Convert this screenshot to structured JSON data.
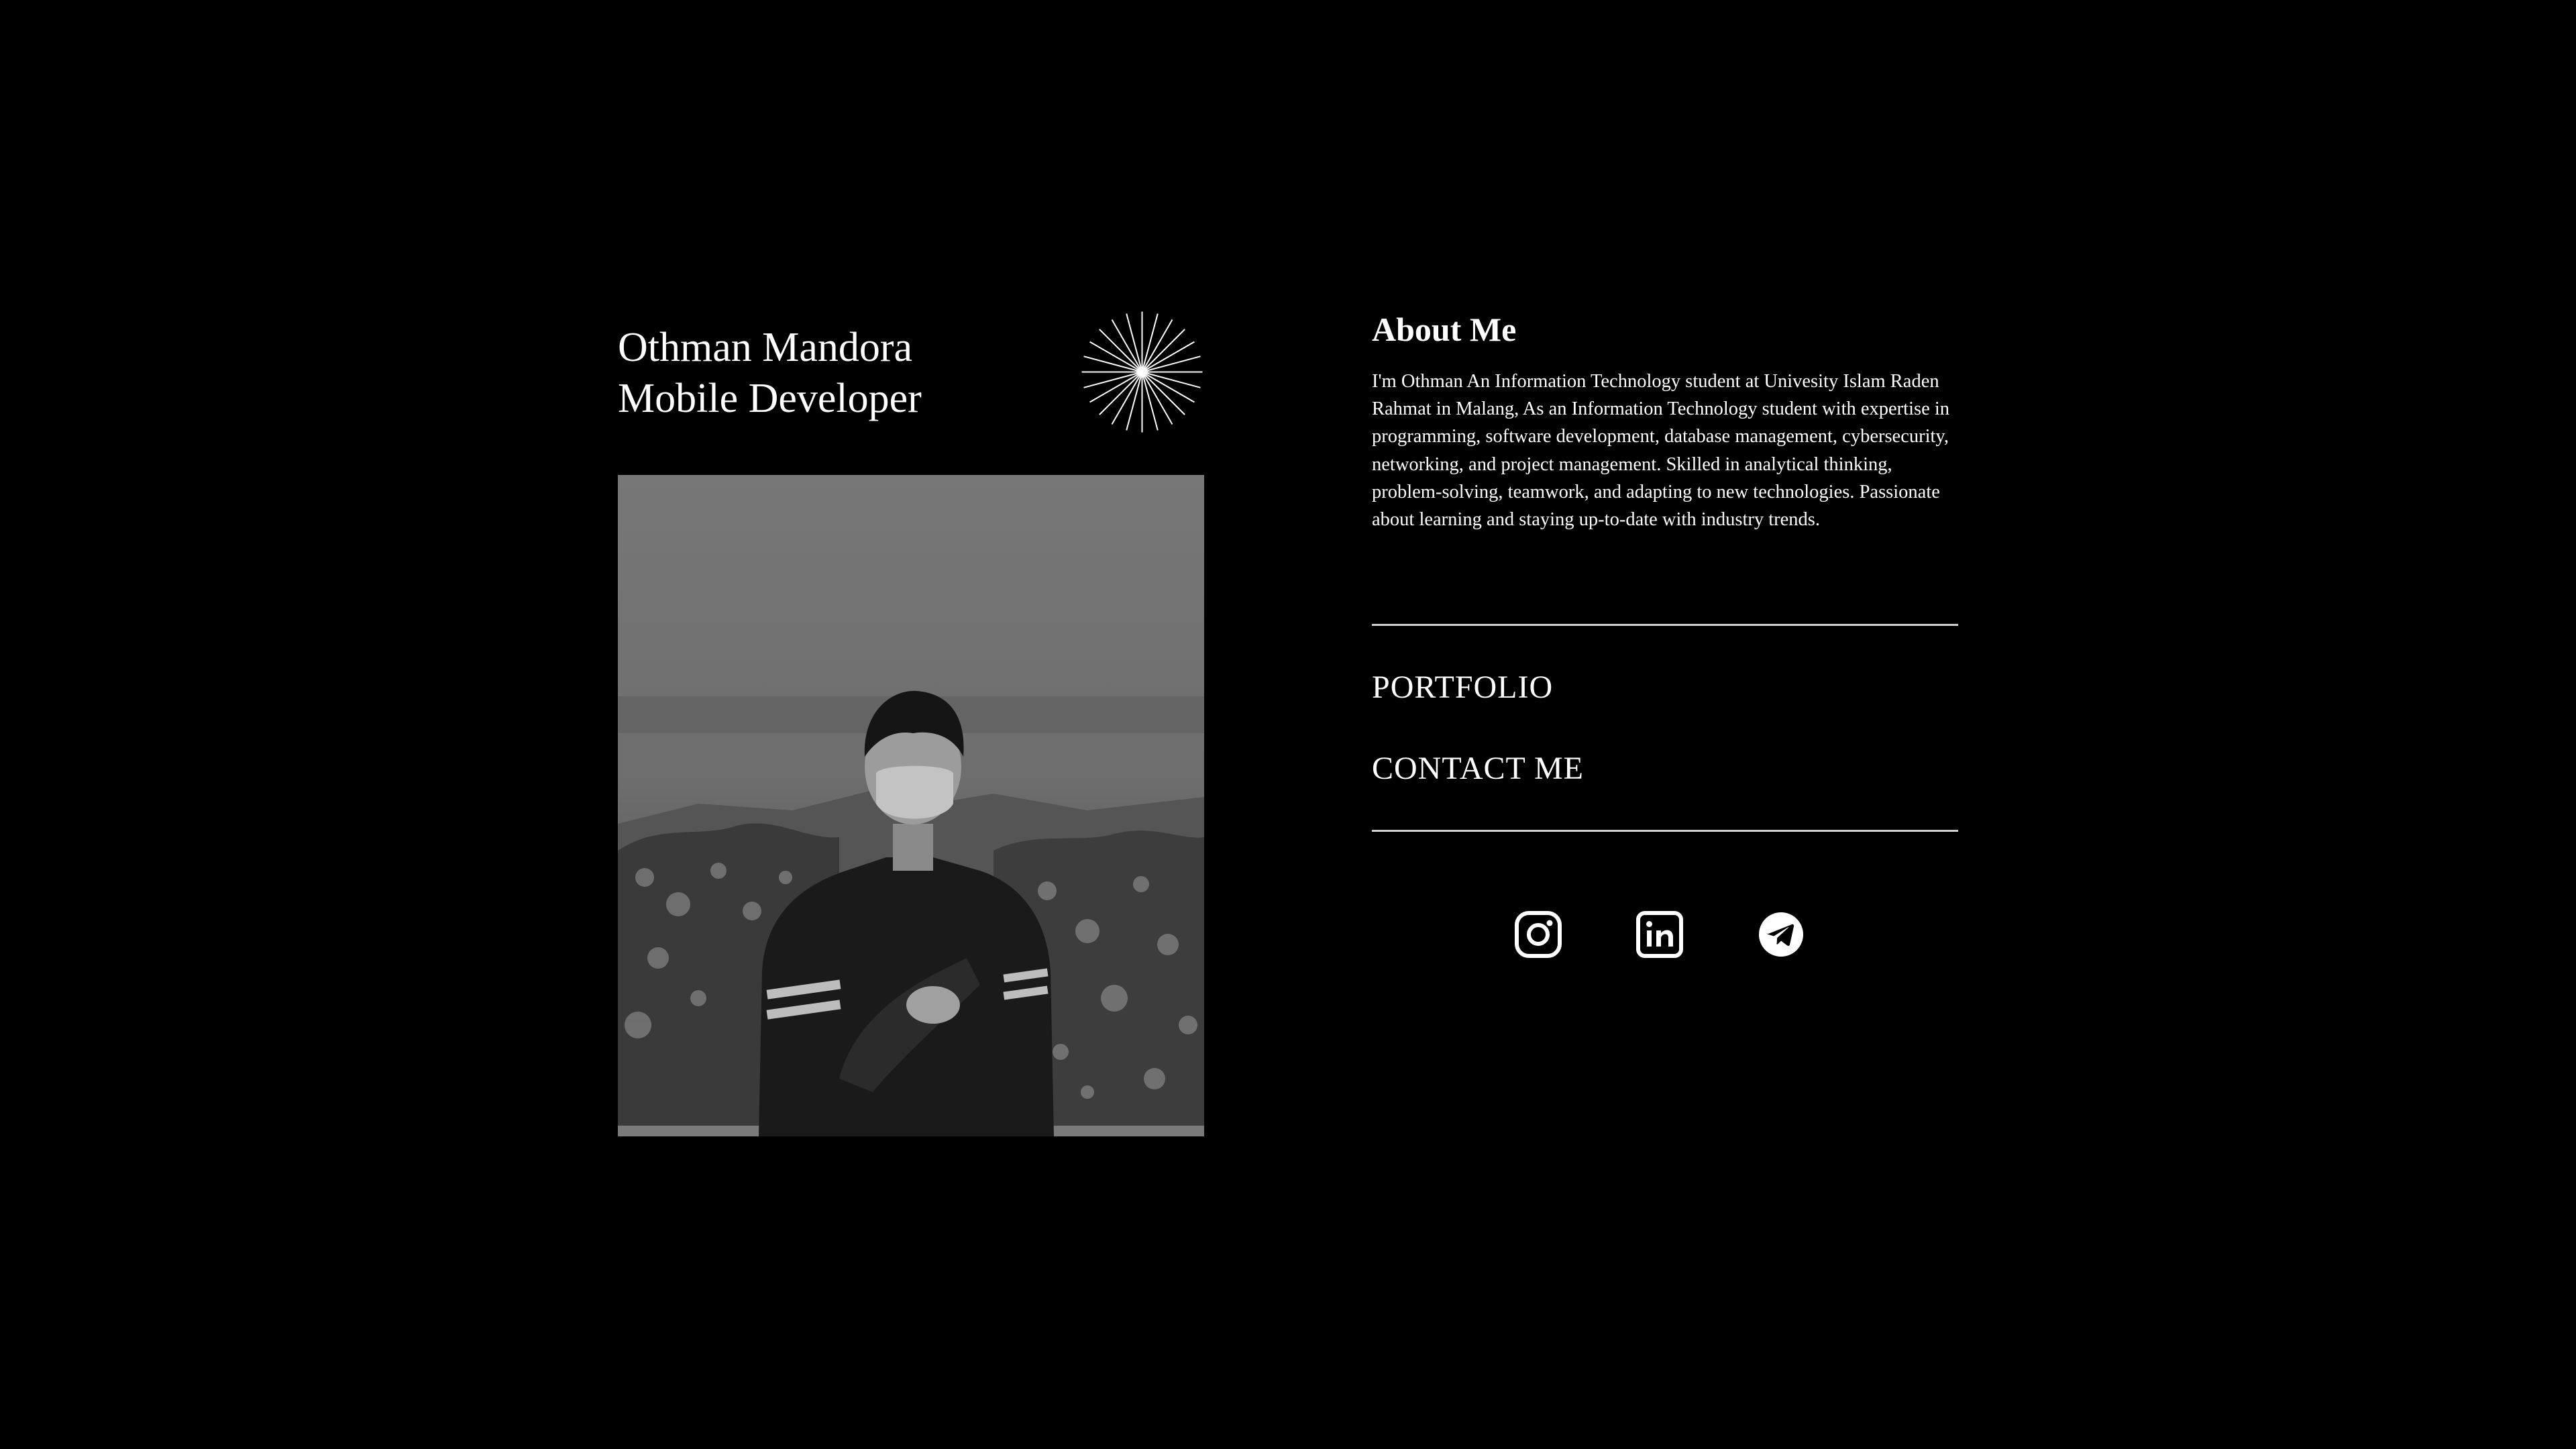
{
  "profile": {
    "name": "Othman Mandora",
    "role": "Mobile Developer"
  },
  "about": {
    "title": "About Me",
    "text": "I'm Othman An Information Technology student at Univesity Islam Raden Rahmat in Malang, As an Information Technology student with expertise in programming, software development, database management, cybersecurity, networking, and project management. Skilled in analytical thinking, problem-solving, teamwork, and adapting to new technologies. Passionate about learning and staying up-to-date with industry trends."
  },
  "nav": {
    "portfolio": "PORTFOLIO",
    "contact": "CONTACT ME"
  },
  "social": [
    {
      "icon": "instagram-icon"
    },
    {
      "icon": "linkedin-icon"
    },
    {
      "icon": "telegram-icon"
    }
  ],
  "colors": {
    "background": "#000000",
    "text": "#ffffff",
    "divider": "#cfcfcf"
  }
}
